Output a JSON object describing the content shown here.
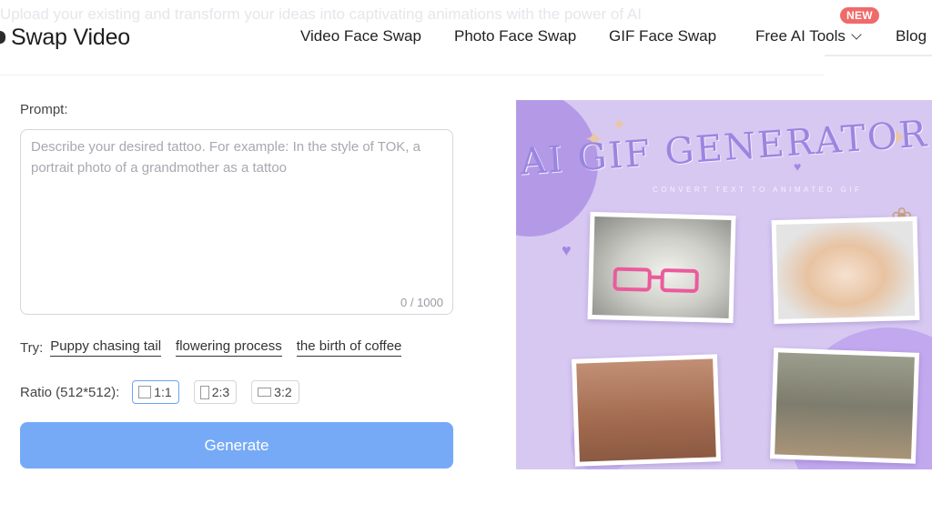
{
  "header": {
    "ghost_text": "Upload your existing and transform your ideas into captivating animations with the power of AI",
    "logo_text": "Swap Video",
    "nav": {
      "video_face_swap": "Video Face Swap",
      "photo_face_swap": "Photo Face Swap",
      "gif_face_swap": "GIF Face Swap",
      "free_ai_tools": "Free AI Tools",
      "blog": "Blog"
    },
    "new_badge": "NEW"
  },
  "form": {
    "prompt_label": "Prompt:",
    "prompt_value": "",
    "prompt_placeholder": "Describe your desired tattoo. For example: In the style of TOK, a portrait photo of a grandmother as a tattoo",
    "counter": "0 / 1000",
    "try_label": "Try:",
    "try_suggestions": [
      "Puppy chasing tail",
      "flowering process",
      "the birth of coffee"
    ],
    "ratio_label": "Ratio (512*512):",
    "ratio_options": [
      "1:1",
      "2:3",
      "3:2"
    ],
    "ratio_selected": "1:1",
    "generate_label": "Generate"
  },
  "banner": {
    "title": "AI GIF GENERATOR",
    "subtitle": "CONVERT TEXT TO ANIMATED GIF"
  },
  "colors": {
    "accent_button": "#76aaf6",
    "selected_border": "#6fa3ef",
    "new_badge": "#f06a6a",
    "banner_bg": "#d7c8f2"
  }
}
